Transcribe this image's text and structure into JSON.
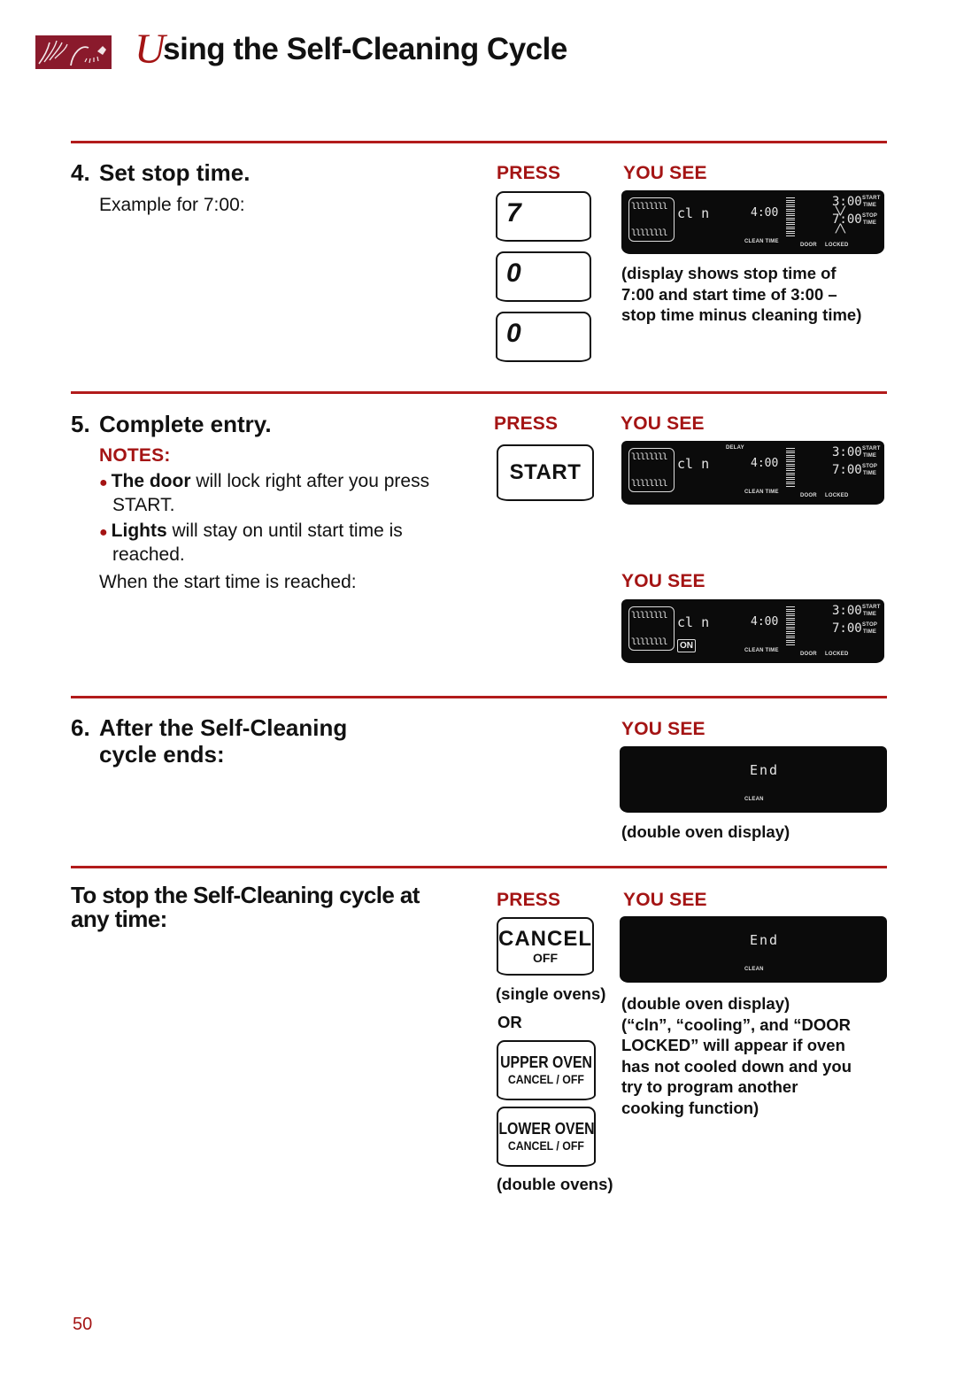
{
  "header": {
    "logo_icon": "wheat-and-flame-logo-icon",
    "title_initial": "U",
    "title_rest": "sing the Self-Cleaning Cycle"
  },
  "colors": {
    "accent_red": "#a41414",
    "rule_red": "#b21b1b",
    "logo_maroon": "#8a1a2c",
    "display_black": "#0b0b0b"
  },
  "step4": {
    "number": "4.",
    "title": "Set stop time.",
    "example": "Example for 7:00:",
    "press_label": "PRESS",
    "you_see_label": "YOU SEE",
    "keys": [
      "7",
      "0",
      "0"
    ],
    "display": {
      "coil_top": "ʅʅʅʅʅʅʅʅ",
      "coil_bottom": "ʅʅʅʅʅʅʅʅ",
      "mode": "cl n",
      "clean_time": "4:00",
      "clean_time_label": "CLEAN TIME",
      "start_time": "3:00",
      "stop_time": "7:00",
      "start_label_1": "START",
      "start_label_2": "TIME",
      "stop_label_1": "STOP",
      "stop_label_2": "TIME",
      "door_label": "DOOR",
      "locked_label": "LOCKED",
      "stop_time_flashing": true
    },
    "caption": "(display shows stop time of 7:00 and start time of 3:00 – stop time minus cleaning time)",
    "caption_lines": [
      "(display shows stop time of",
      "7:00 and start time of 3:00 –",
      "stop time minus cleaning time)"
    ]
  },
  "step5": {
    "number": "5.",
    "title": "Complete entry.",
    "notes_label": "NOTES:",
    "notes": [
      {
        "bold": "The door",
        "text": " will lock right after you press",
        "text2": "START."
      },
      {
        "bold": "Lights",
        "text": " will stay on until start time is",
        "text2": "reached."
      }
    ],
    "when_reached": "When the start time is reached:",
    "press_label": "PRESS",
    "you_see_label": "YOU SEE",
    "you_see_label_2": "YOU SEE",
    "start_key": "START",
    "display1": {
      "delay_label": "DELAY",
      "mode": "cl n",
      "clean_time": "4:00",
      "clean_time_label": "CLEAN TIME",
      "start_time": "3:00",
      "stop_time": "7:00",
      "start_label_1": "START",
      "start_label_2": "TIME",
      "stop_label_1": "STOP",
      "stop_label_2": "TIME",
      "door_label": "DOOR",
      "locked_label": "LOCKED"
    },
    "display2": {
      "on_badge": "ON",
      "mode": "cl n",
      "clean_time": "4:00",
      "clean_time_label": "CLEAN TIME",
      "start_time": "3:00",
      "stop_time": "7:00",
      "start_label_1": "START",
      "start_label_2": "TIME",
      "stop_label_1": "STOP",
      "stop_label_2": "TIME",
      "door_label": "DOOR",
      "locked_label": "LOCKED"
    }
  },
  "step6": {
    "number": "6.",
    "title_line1": "After the Self-Cleaning",
    "title_line2": "cycle ends:",
    "you_see_label": "YOU SEE",
    "display": {
      "readout": "End",
      "label": "CLEAN"
    },
    "caption": "(double oven display)"
  },
  "stop_section": {
    "title_line1": "To stop the Self-Cleaning cycle at",
    "title_line2": "any time:",
    "press_label": "PRESS",
    "you_see_label": "YOU SEE",
    "cancel_key": {
      "line1": "CANCEL",
      "line2": "OFF"
    },
    "single_ovens": "(single ovens)",
    "or_label": "OR",
    "upper_key": {
      "line1": "UPPER OVEN",
      "line2": "CANCEL / OFF"
    },
    "lower_key": {
      "line1": "LOWER OVEN",
      "line2": "CANCEL / OFF"
    },
    "double_ovens": "(double ovens)",
    "display": {
      "readout": "End",
      "label": "CLEAN"
    },
    "caption_lines": [
      "(double oven display)",
      "(“cln”, “cooling”, and “DOOR",
      "LOCKED” will appear if oven",
      "has not cooled down and you",
      "try to program another",
      "cooking function)"
    ]
  },
  "page_number": "50"
}
